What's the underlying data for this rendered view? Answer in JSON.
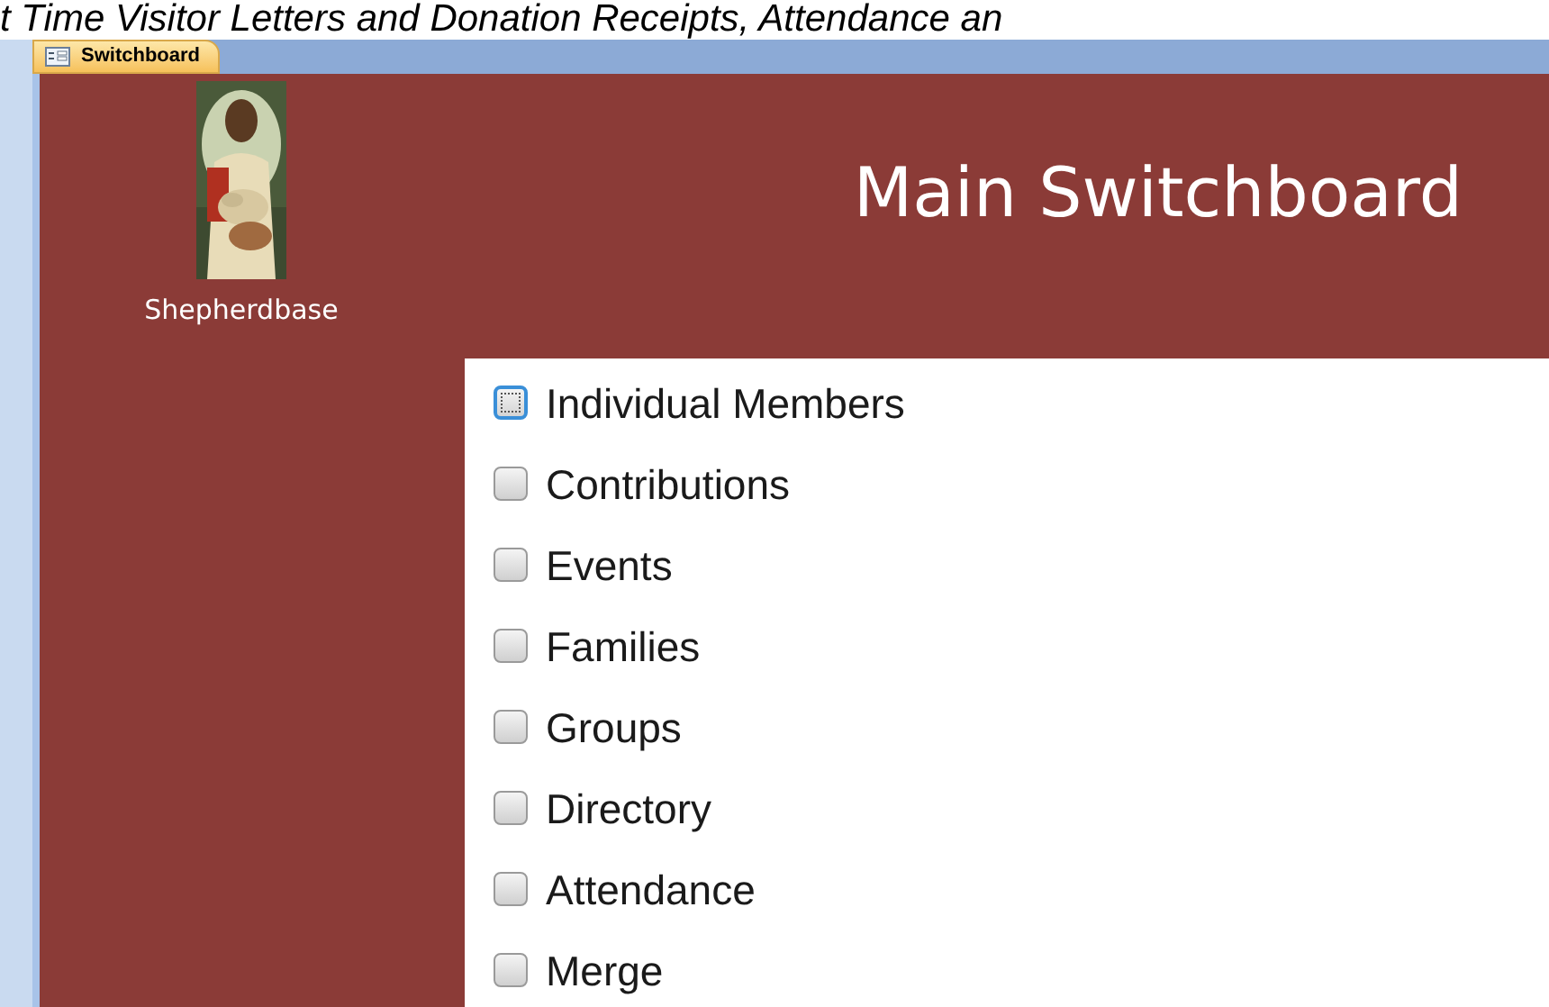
{
  "header_text": "t Time Visitor Letters and Donation Receipts, Attendance an",
  "tabs": [
    {
      "label": "Switchboard",
      "selected": true
    }
  ],
  "logo": {
    "caption": "Shepherdbase"
  },
  "title": "Main Switchboard",
  "items": [
    {
      "label": "Individual Members",
      "selected": true
    },
    {
      "label": "Contributions",
      "selected": false
    },
    {
      "label": "Events",
      "selected": false
    },
    {
      "label": "Families",
      "selected": false
    },
    {
      "label": "Groups",
      "selected": false
    },
    {
      "label": "Directory",
      "selected": false
    },
    {
      "label": "Attendance",
      "selected": false
    },
    {
      "label": "Merge",
      "selected": false
    }
  ]
}
